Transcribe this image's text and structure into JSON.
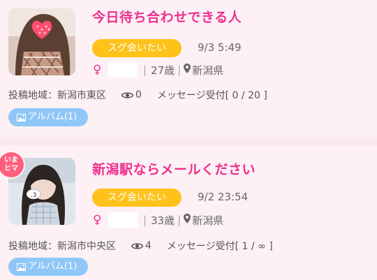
{
  "posts": [
    {
      "title": "今日待ち合わせできる人",
      "badge": "スグ会いたい",
      "datetime": "9/3 5:49",
      "gender_symbol": "♀",
      "age": "27歳",
      "prefecture": "新潟県",
      "area": "投稿地域：新潟市東区",
      "views": "0",
      "messages": "メッセージ受付[ 0 / 20 ]",
      "album": "アルバム(1)",
      "online_badge": ""
    },
    {
      "title": "新潟駅ならメールください",
      "badge": "スグ会いたい",
      "datetime": "9/2 23:54",
      "gender_symbol": "♀",
      "age": "33歳",
      "prefecture": "新潟県",
      "area": "投稿地域：新潟市中央区",
      "views": "4",
      "messages": "メッセージ受付[ 1 / ∞ ]",
      "album": "アルバム(1)",
      "online_badge": "いまヒマ"
    }
  ],
  "colors": {
    "title": "#ee2f8e",
    "badge": "#ffc21a",
    "album": "#8fc7f7",
    "online": "#ff5f7e"
  }
}
